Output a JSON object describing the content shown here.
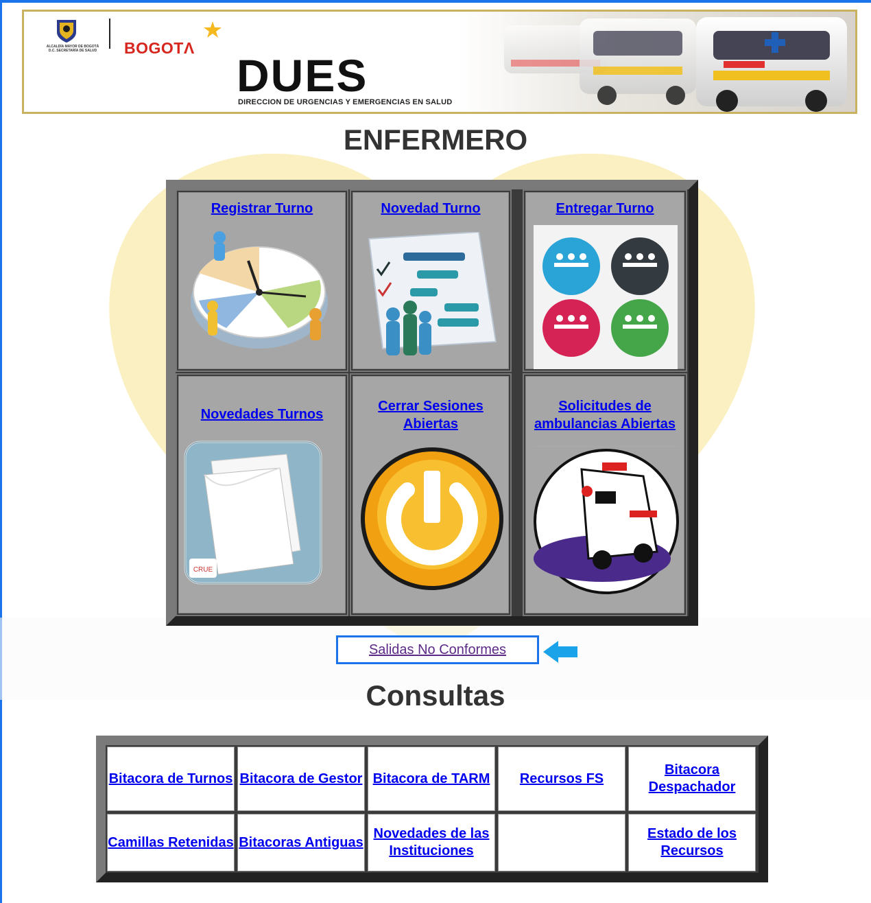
{
  "banner": {
    "crest_text": "ALCALDÍA MAYOR DE BOGOTÁ D.C. SECRETARÍA DE SALUD",
    "bogota": "BOGOTΛ",
    "title": "DUES",
    "subtitle": "DIRECCION DE URGENCIAS Y EMERGENCIAS EN SALUD"
  },
  "page_title": "ENFERMERO",
  "main_options": [
    {
      "label": "Registrar Turno",
      "icon": "clock-team-icon"
    },
    {
      "label": "Novedad Turno",
      "icon": "gantt-chart-icon"
    },
    {
      "label": "Entregar Turno",
      "icon": "team-arrows-icon"
    },
    {
      "label": "Novedades Turnos",
      "icon": "papers-icon"
    },
    {
      "label": "Cerrar Sesiones Abiertas",
      "icon": "power-icon"
    },
    {
      "label": "Solicitudes de ambulancias Abiertas",
      "icon": "ambulance-icon"
    }
  ],
  "papers_logo": "CRUE",
  "salidas_link": "Salidas No Conformes",
  "consultas_title": "Consultas",
  "consultas": [
    "Bitacora de Turnos",
    "Bitacora de Gestor",
    "Bitacora de TARM",
    "Recursos FS",
    "Bitacora Despachador",
    "Camillas Retenidas",
    "Bitacoras Antiguas",
    "Novedades de las Instituciones",
    "",
    "Estado de los Recursos"
  ],
  "colors": {
    "link": "#0000ee",
    "visited": "#5b2a86",
    "frame": "#1a73e8",
    "grid_border": "#3b3b3b"
  }
}
